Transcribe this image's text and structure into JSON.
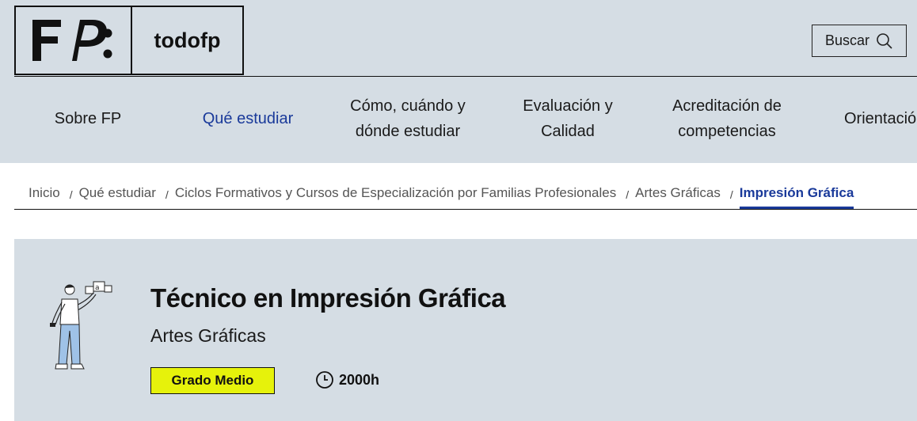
{
  "header": {
    "logo_mark": "FP:",
    "logo_name": "todofp",
    "search_label": "Buscar"
  },
  "nav": {
    "items": [
      {
        "label": "Sobre FP"
      },
      {
        "label": "Qué estudiar"
      },
      {
        "label": "Cómo, cuándo y\ndónde estudiar"
      },
      {
        "label": "Evaluación y\nCalidad"
      },
      {
        "label": "Acreditación de\ncompetencias"
      },
      {
        "label": "Orientación"
      }
    ],
    "active": "Qué estudiar"
  },
  "breadcrumb": {
    "items": [
      "Inicio",
      "Qué estudiar",
      "Ciclos Formativos y Cursos de Especialización por Familias Profesionales",
      "Artes Gráficas"
    ],
    "separator": "/",
    "current": "Impresión Gráfica"
  },
  "course": {
    "title": "Técnico en Impresión Gráfica",
    "family": "Artes Gráficas",
    "level": "Grado Medio",
    "duration": "2000h"
  },
  "colors": {
    "header_bg": "#d5dde4",
    "accent_blue": "#1a3a9a",
    "badge_yellow": "#e6f20b"
  }
}
